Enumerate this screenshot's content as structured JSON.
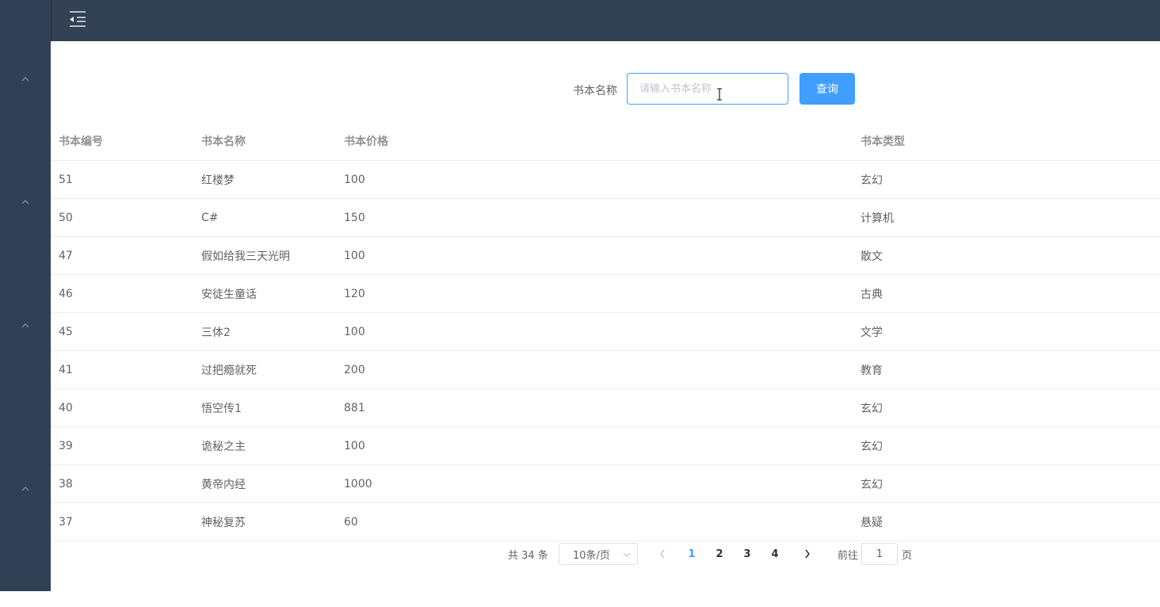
{
  "colors": {
    "sidebar": "#304156",
    "topbar": "#334155",
    "accent": "#409eff"
  },
  "header": {
    "menu_icon": "hamburger-fold-icon"
  },
  "sidebar": {
    "chevrons": [
      "chevron-up-icon",
      "chevron-up-icon",
      "chevron-up-icon",
      "chevron-up-icon"
    ]
  },
  "search": {
    "label": "书本名称",
    "placeholder": "请输入书本名称",
    "value": "",
    "button_label": "查询"
  },
  "table": {
    "columns": [
      "书本编号",
      "书本名称",
      "书本价格",
      "书本类型"
    ],
    "rows": [
      [
        "51",
        "红楼梦",
        "100",
        "玄幻"
      ],
      [
        "50",
        "C#",
        "150",
        "计算机"
      ],
      [
        "47",
        "假如给我三天光明",
        "100",
        "散文"
      ],
      [
        "46",
        "安徒生童话",
        "120",
        "古典"
      ],
      [
        "45",
        "三体2",
        "100",
        "文学"
      ],
      [
        "41",
        "过把瘾就死",
        "200",
        "教育"
      ],
      [
        "40",
        "悟空传1",
        "881",
        "玄幻"
      ],
      [
        "39",
        "诡秘之主",
        "100",
        "玄幻"
      ],
      [
        "38",
        "黄帝内经",
        "1000",
        "玄幻"
      ],
      [
        "37",
        "神秘复苏",
        "60",
        "悬疑"
      ]
    ]
  },
  "pagination": {
    "total_text": "共 34 条",
    "page_size": "10条/页",
    "pages": [
      "1",
      "2",
      "3",
      "4"
    ],
    "current_page": "1",
    "goto_prefix": "前往",
    "goto_value": "1",
    "goto_suffix": "页"
  }
}
